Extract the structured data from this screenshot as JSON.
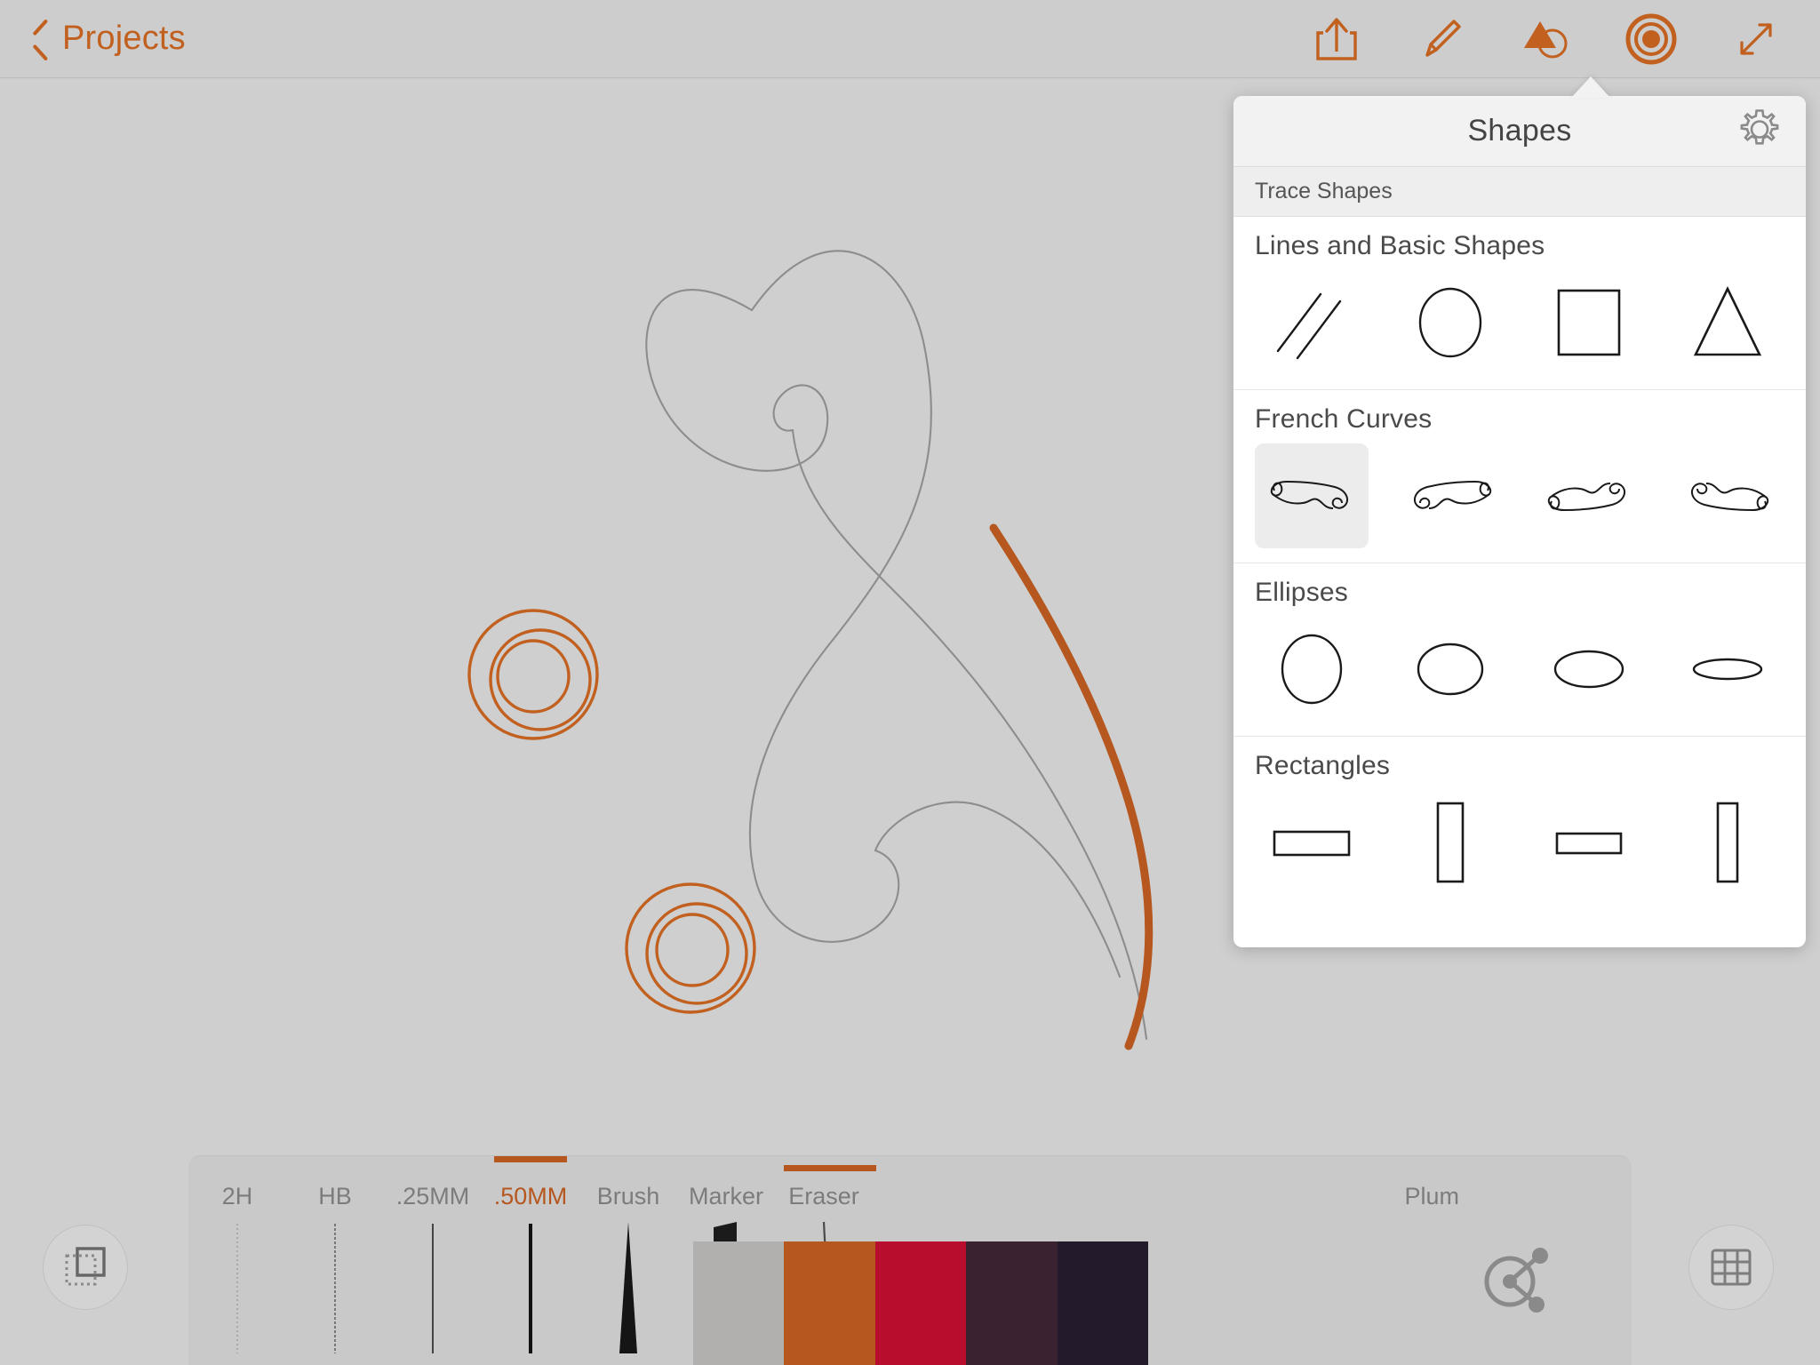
{
  "app": {
    "accent_color": "#c1601f",
    "stroke_color": "#b5571f",
    "canvas_color": "#cfcfcf",
    "chrome_color": "#cdcdcd"
  },
  "topbar": {
    "back_label": "Projects",
    "back_icon": "chevron-left-icon",
    "tools": [
      {
        "name": "share-icon",
        "label": "Share"
      },
      {
        "name": "pencil-icon",
        "label": "Draw"
      },
      {
        "name": "shapes-icon",
        "label": "Shapes"
      },
      {
        "name": "color-icon",
        "label": "Color"
      },
      {
        "name": "expand-icon",
        "label": "Full Screen"
      }
    ]
  },
  "panel": {
    "title": "Shapes",
    "settings_icon": "gear-icon",
    "subheader": "Trace Shapes",
    "sections": [
      {
        "title": "Lines and Basic Shapes",
        "items": [
          {
            "name": "shape-lines",
            "label": "Lines"
          },
          {
            "name": "shape-circle",
            "label": "Circle"
          },
          {
            "name": "shape-rectangle",
            "label": "Rectangle"
          },
          {
            "name": "shape-triangle",
            "label": "Triangle"
          }
        ]
      },
      {
        "title": "French Curves",
        "items": [
          {
            "name": "shape-french-curve-1",
            "label": "French Curve 1",
            "selected": true
          },
          {
            "name": "shape-french-curve-2",
            "label": "French Curve 2"
          },
          {
            "name": "shape-french-curve-3",
            "label": "French Curve 3"
          },
          {
            "name": "shape-french-curve-4",
            "label": "French Curve 4"
          }
        ]
      },
      {
        "title": "Ellipses",
        "items": [
          {
            "name": "shape-ellipse-1",
            "label": "Ellipse Tall"
          },
          {
            "name": "shape-ellipse-2",
            "label": "Ellipse Round"
          },
          {
            "name": "shape-ellipse-3",
            "label": "Ellipse Wide"
          },
          {
            "name": "shape-ellipse-4",
            "label": "Ellipse Flat"
          }
        ]
      },
      {
        "title": "Rectangles",
        "items": [
          {
            "name": "shape-rect-1",
            "label": "Rectangle Wide"
          },
          {
            "name": "shape-rect-2",
            "label": "Rectangle Tall"
          },
          {
            "name": "shape-rect-3",
            "label": "Rectangle Small Wide"
          },
          {
            "name": "shape-rect-4",
            "label": "Rectangle Small Tall"
          }
        ]
      }
    ]
  },
  "bottombar": {
    "tools": [
      {
        "label": "2H",
        "active": false
      },
      {
        "label": "HB",
        "active": false
      },
      {
        "label": ".25MM",
        "active": false
      },
      {
        "label": ".50MM",
        "active": true
      },
      {
        "label": "Brush",
        "active": false
      },
      {
        "label": "Marker",
        "active": false
      },
      {
        "label": "Eraser",
        "active": false
      }
    ],
    "palette_name": "Plum",
    "swatches": [
      {
        "color": "#b2b0ae",
        "selected": false
      },
      {
        "color": "#b5571f",
        "selected": true
      },
      {
        "color": "#b80d2c",
        "selected": false
      },
      {
        "color": "#3b2230",
        "selected": false
      },
      {
        "color": "#231a2c",
        "selected": false
      }
    ],
    "color_wheel_icon": "color-harmony-icon",
    "layers_button": "layers-icon",
    "grid_button": "grid-icon"
  }
}
